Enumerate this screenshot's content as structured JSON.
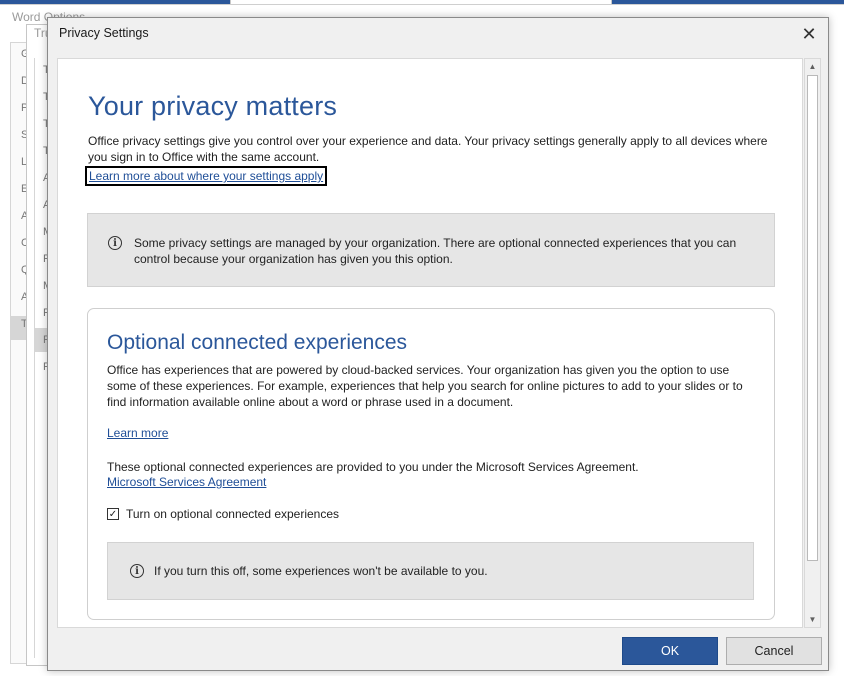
{
  "background": {
    "word_options_title": "Word Options",
    "trust_center_title": "Trust Center",
    "left_letters": [
      "G",
      "D",
      "P",
      "S",
      "L",
      "E",
      "A",
      "C",
      "Q",
      "A",
      "T"
    ],
    "tc_letters": [
      "T",
      "T",
      "T",
      "T",
      "A",
      "A",
      "M",
      "P",
      "M",
      "F",
      "P",
      "F"
    ]
  },
  "dialog": {
    "title": "Privacy Settings",
    "close_glyph": "✕",
    "heading": "Your privacy matters",
    "intro": "Office privacy settings give you control over your experience and data. Your privacy settings generally apply to all devices where you sign in to Office with the same account.",
    "settings_link": "Learn more about where your settings apply",
    "org_notice": "Some privacy settings are managed by your organization. There are optional connected experiences that you can control because your organization has given you this option.",
    "section": {
      "title": "Optional connected experiences",
      "description": "Office has experiences that are powered by cloud-backed services. Your organization has given you the option to use some of these experiences. For example, experiences that help you search for online pictures to add to your slides or to find information available online about a word or phrase used in a document.",
      "learn_more": "Learn more",
      "agreement_text": "These optional connected experiences are provided to you under the Microsoft Services Agreement.",
      "agreement_link": "Microsoft Services Agreement",
      "checkbox_label": "Turn on optional connected experiences",
      "checkbox_checked": true,
      "warning": "If you turn this off, some experiences won't be available to you."
    },
    "buttons": {
      "ok": "OK",
      "cancel": "Cancel"
    },
    "scroll_up": "▲",
    "scroll_down": "▼",
    "info_glyph": "i",
    "check_glyph": "✓"
  },
  "colors": {
    "accent": "#2b579a",
    "link": "#1f4e97",
    "notice_bg": "#e6e6e6"
  }
}
